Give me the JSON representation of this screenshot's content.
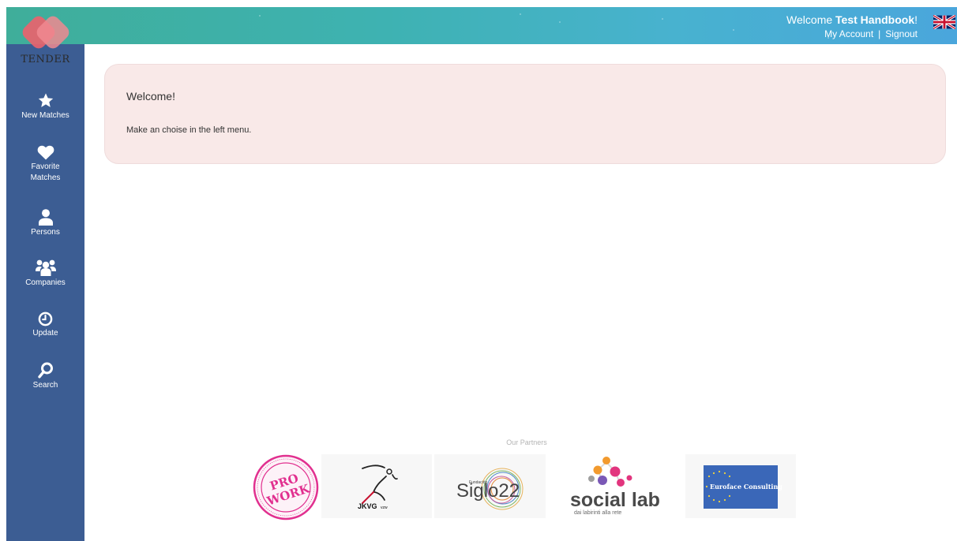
{
  "header": {
    "welcome_prefix": "Welcome ",
    "user_name": "Test Handbook",
    "welcome_suffix": "!",
    "my_account": "My Account",
    "separator": "|",
    "signout": "Signout",
    "language_icon": "uk-flag-icon"
  },
  "brand": {
    "logo_text": "TENDER"
  },
  "sidebar": {
    "items": [
      {
        "label": "New Matches",
        "icon": "star-icon"
      },
      {
        "label": "Favorite\nMatches",
        "icon": "heart-icon"
      },
      {
        "label": "Persons",
        "icon": "person-icon"
      },
      {
        "label": "Companies",
        "icon": "group-icon"
      },
      {
        "label": "Update",
        "icon": "clock-icon"
      },
      {
        "label": "Search",
        "icon": "search-icon"
      }
    ]
  },
  "main": {
    "welcome_title": "Welcome!",
    "welcome_text": "Make an choise in the left menu."
  },
  "partners": {
    "title": "Our Partners",
    "logos": [
      {
        "top_text": "PRO",
        "bottom_text": "WORK"
      },
      {
        "text": "JKVG",
        "suffix": "vzw"
      },
      {
        "small_text": "Fundación",
        "text": "Siglo22"
      },
      {
        "text": "social lab",
        "subtext": "dai labirinti alla rete"
      },
      {
        "text": "Euroface Consulting"
      }
    ]
  },
  "colors": {
    "sidebar": "#3c5d93",
    "card_background": "#f9e9e8",
    "header_gradient_start": "#3fae9a",
    "header_gradient_end": "#4aa6dc"
  }
}
